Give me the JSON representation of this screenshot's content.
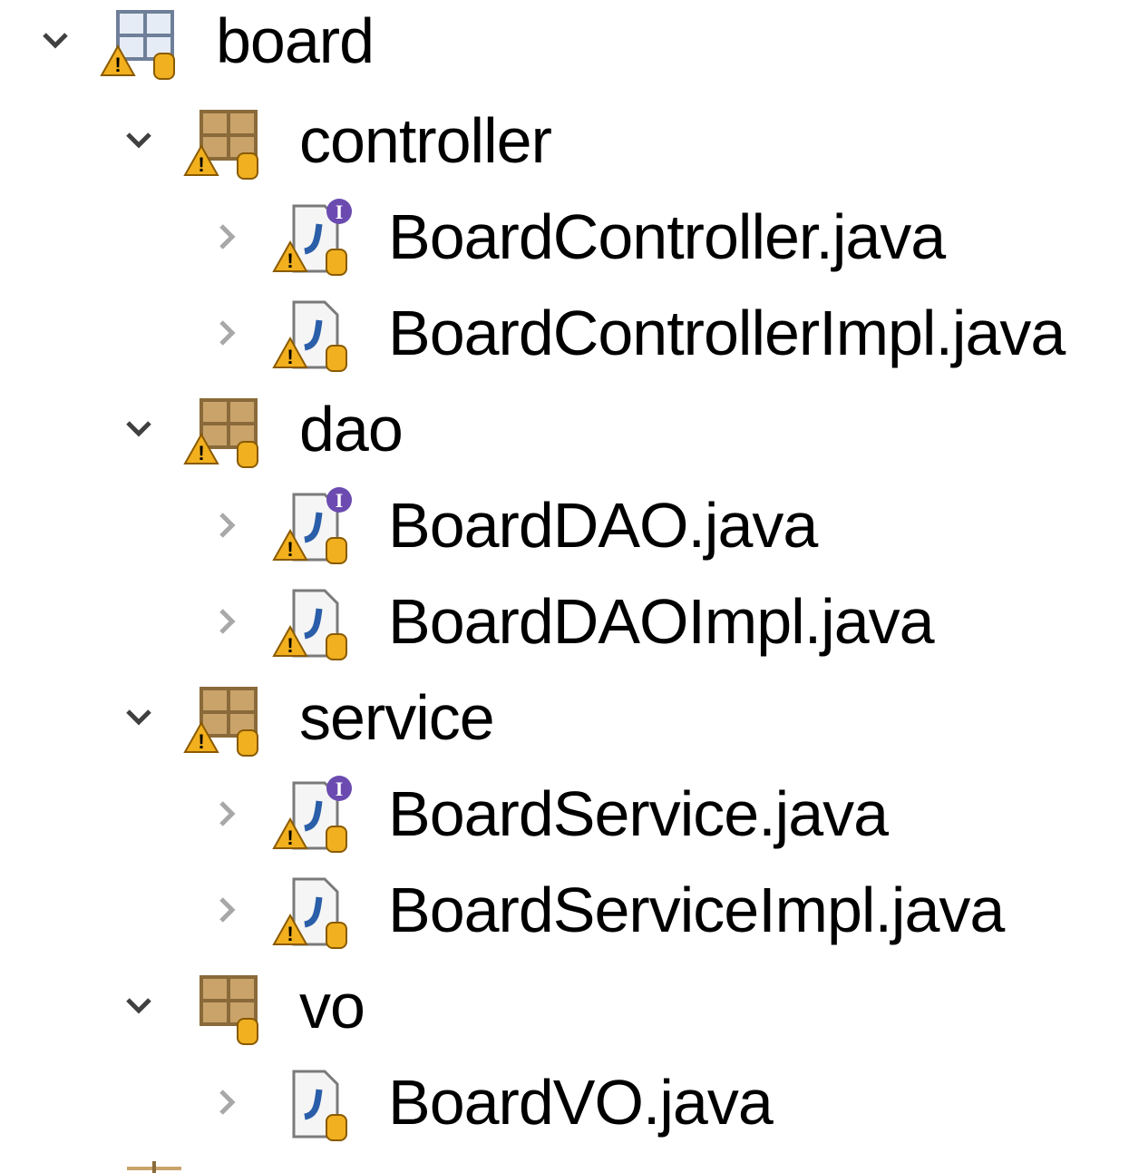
{
  "tree": {
    "root": {
      "label": "board",
      "icon": "package-icon",
      "expanded": true,
      "warning": true
    },
    "packages": [
      {
        "label": "controller",
        "expanded": true,
        "warning": true,
        "files": [
          {
            "label": "BoardController.java",
            "kind": "interface",
            "warning": true
          },
          {
            "label": "BoardControllerImpl.java",
            "kind": "class",
            "warning": true
          }
        ]
      },
      {
        "label": "dao",
        "expanded": true,
        "warning": true,
        "files": [
          {
            "label": "BoardDAO.java",
            "kind": "interface",
            "warning": true
          },
          {
            "label": "BoardDAOImpl.java",
            "kind": "class",
            "warning": true
          }
        ]
      },
      {
        "label": "service",
        "expanded": true,
        "warning": true,
        "files": [
          {
            "label": "BoardService.java",
            "kind": "interface",
            "warning": true
          },
          {
            "label": "BoardServiceImpl.java",
            "kind": "class",
            "warning": true
          }
        ]
      },
      {
        "label": "vo",
        "expanded": true,
        "warning": false,
        "files": [
          {
            "label": "BoardVO.java",
            "kind": "class",
            "warning": false
          }
        ]
      }
    ]
  },
  "colors": {
    "package": "#8a6a3a",
    "package_light": "#c9a36a",
    "warning": "#f2b01e",
    "db_cylinder": "#f0b020",
    "java_blue": "#2a5ea8",
    "interface_badge": "#6b4bb0",
    "chevron_expanded": "#404040",
    "chevron_collapsed": "#a8a8a8"
  }
}
